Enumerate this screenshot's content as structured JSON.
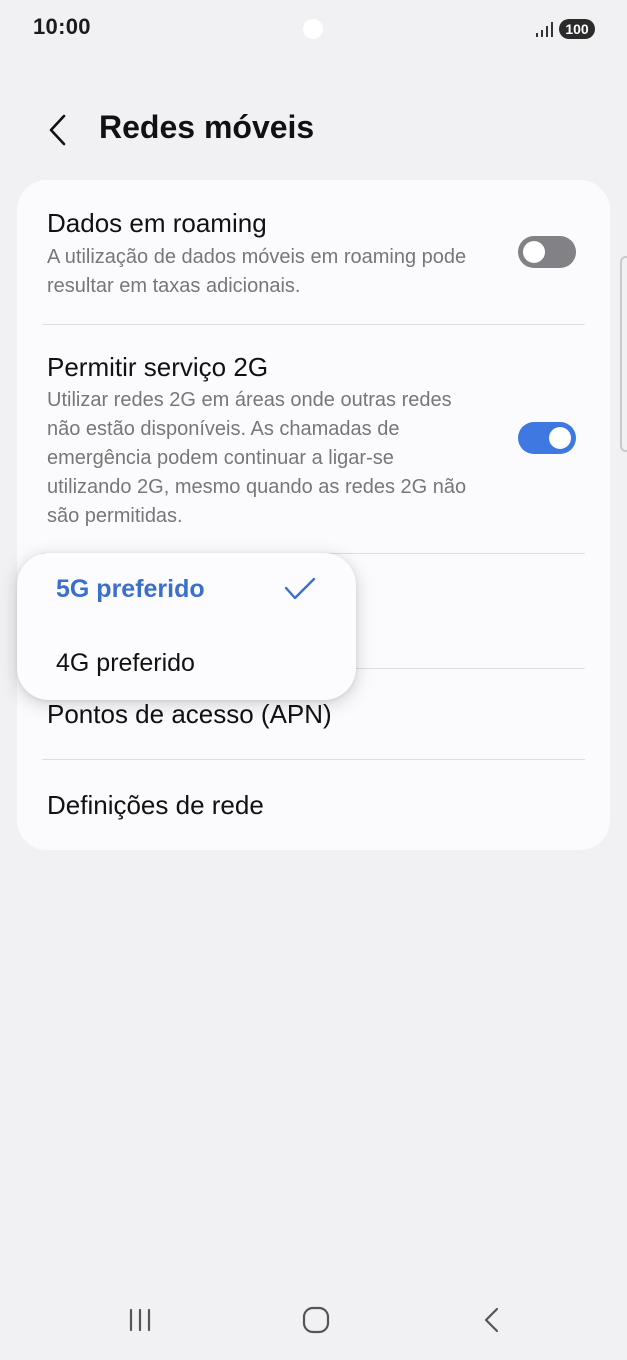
{
  "status_bar": {
    "time": "10:00",
    "battery": "100"
  },
  "header": {
    "title": "Redes móveis"
  },
  "settings": {
    "roaming": {
      "title": "Dados em roaming",
      "subtitle": "A utilização de dados móveis em roaming pode resultar em taxas adicionais.",
      "enabled": false
    },
    "allow_2g": {
      "title": "Permitir serviço 2G",
      "subtitle": "Utilizar redes 2G em áreas onde outras redes não estão disponíveis. As chamadas de emergência podem continuar a ligar-se utilizando 2G, mesmo quando as redes 2G não são permitidas.",
      "enabled": true
    },
    "apn": {
      "title": "Pontos de acesso (APN)"
    },
    "network_settings": {
      "title": "Definições de rede"
    }
  },
  "network_mode_popup": {
    "options": [
      {
        "label": "5G preferido",
        "selected": true
      },
      {
        "label": "4G preferido",
        "selected": false
      }
    ]
  },
  "colors": {
    "accent": "#3e78e0",
    "selected_text": "#3a6fce",
    "background": "#f1f1f3",
    "card": "#fbfbfd"
  },
  "icons": {
    "back": "chevron-left-icon",
    "check": "check-icon",
    "signal": "signal-icon",
    "nav_recents": "recents-icon",
    "nav_home": "home-icon",
    "nav_back": "back-icon"
  }
}
